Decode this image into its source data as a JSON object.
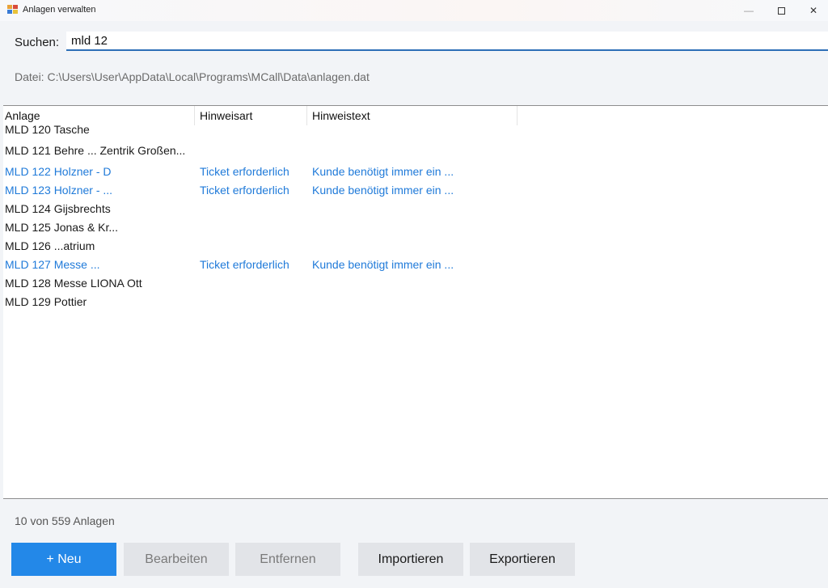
{
  "window": {
    "title": "Anlagen verwalten",
    "controls": {
      "minimize": "—",
      "close": "✕"
    }
  },
  "search": {
    "label": "Suchen:",
    "value": "mld 12"
  },
  "file": {
    "path": "Datei: C:\\Users\\User\\AppData\\Local\\Programs\\MCall\\Data\\anlagen.dat"
  },
  "list": {
    "columns": [
      "Anlage",
      "Hinweisart",
      "Hinweistext"
    ],
    "rows": [
      {
        "anlage": "MLD 120 Tasche",
        "hinweisart": "",
        "hinweistext": "",
        "hint": false
      },
      {
        "anlage": "MLD 121 Behre ... Zentrik Großen...",
        "hinweisart": "",
        "hinweistext": "",
        "hint": false
      },
      {
        "anlage": "MLD 122 Holzner - D",
        "hinweisart": "Ticket erforderlich",
        "hinweistext": "Kunde benötigt immer ein ...",
        "hint": true
      },
      {
        "anlage": "MLD 123 Holzner - ...",
        "hinweisart": "Ticket erforderlich",
        "hinweistext": "Kunde benötigt immer ein ...",
        "hint": true
      },
      {
        "anlage": "MLD 124 Gijsbrechts",
        "hinweisart": "",
        "hinweistext": "",
        "hint": false
      },
      {
        "anlage": "MLD 125 Jonas & Kr...",
        "hinweisart": "",
        "hinweistext": "",
        "hint": false
      },
      {
        "anlage": "MLD 126 ...atrium",
        "hinweisart": "",
        "hinweistext": "",
        "hint": false
      },
      {
        "anlage": "MLD 127 Messe ...",
        "hinweisart": "Ticket erforderlich",
        "hinweistext": "Kunde benötigt immer ein ...",
        "hint": true
      },
      {
        "anlage": "MLD 128 Messe LIONA Ott",
        "hinweisart": "",
        "hinweistext": "",
        "hint": false
      },
      {
        "anlage": "MLD 129 Pottier",
        "hinweisart": "",
        "hinweistext": "",
        "hint": false
      }
    ]
  },
  "status": {
    "count_text": "10 von 559 Anlagen"
  },
  "buttons": {
    "neu": "+ Neu",
    "bearbeiten": "Bearbeiten",
    "entfernen": "Entfernen",
    "importieren": "Importieren",
    "exportieren": "Exportieren"
  },
  "colors": {
    "accent": "#2388e8",
    "hint_text": "#1f7ad9",
    "input_underline": "#2d6fb7"
  }
}
